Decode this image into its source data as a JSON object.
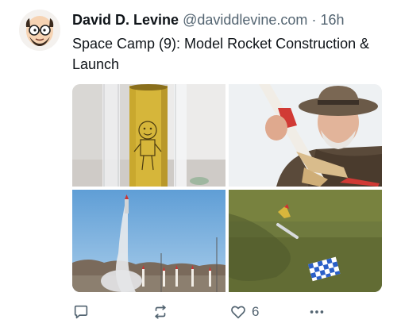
{
  "post": {
    "author": {
      "display_name": "David D. Levine",
      "handle": "@daviddlevine.com",
      "separator": "·",
      "timestamp": "16h"
    },
    "text": "Space Camp (9): Model Rocket Construction & Launch",
    "media": [
      {
        "alt": "Cardboard rocket tube with a hand-drawn cartoon figure"
      },
      {
        "alt": "Bearded man in a wide-brimmed hat holding a model rocket"
      },
      {
        "alt": "Model rocket launching into a blue sky with smoke trail"
      },
      {
        "alt": "Spent rocket and blue checkered parachute lying on grass"
      }
    ],
    "actions": {
      "reply_icon": "reply-icon",
      "repost_icon": "repost-icon",
      "like_icon": "heart-icon",
      "like_count": "6",
      "more_icon": "more-icon"
    }
  },
  "colors": {
    "text_primary": "#0f1419",
    "text_secondary": "#536471",
    "background": "#ffffff"
  }
}
